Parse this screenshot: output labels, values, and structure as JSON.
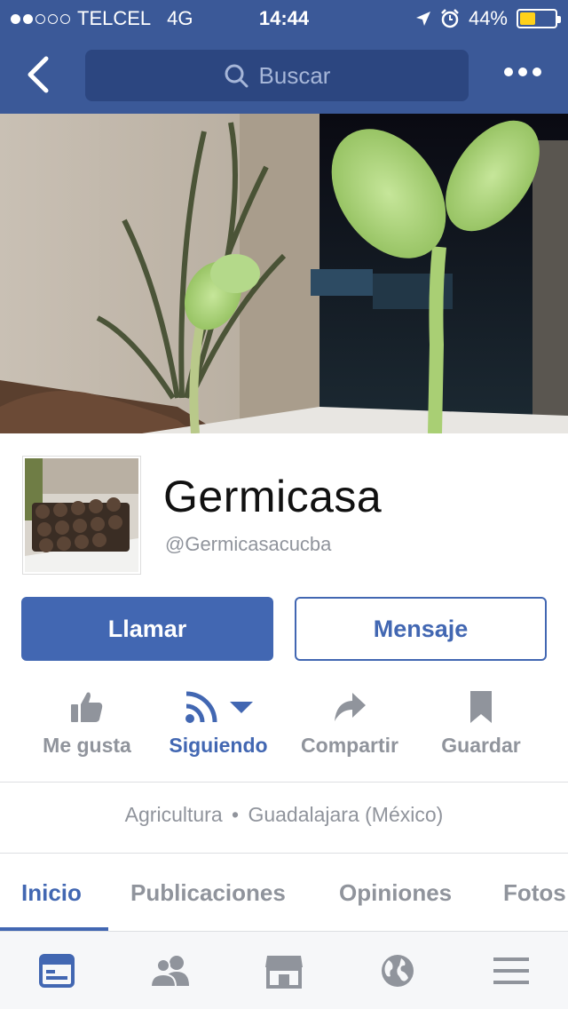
{
  "status_bar": {
    "carrier": "TELCEL",
    "network": "4G",
    "time": "14:44",
    "battery": "44%",
    "battery_level": 0.44
  },
  "nav": {
    "search_placeholder": "Buscar"
  },
  "page": {
    "name": "Germicasa",
    "handle": "@Germicasacucba"
  },
  "cta": {
    "call_label": "Llamar",
    "message_label": "Mensaje"
  },
  "actions": [
    {
      "label": "Me gusta",
      "icon": "thumbs-up-icon"
    },
    {
      "label": "Siguiendo",
      "icon": "rss-icon"
    },
    {
      "label": "Compartir",
      "icon": "share-icon"
    },
    {
      "label": "Guardar",
      "icon": "bookmark-icon"
    }
  ],
  "info": {
    "category": "Agricultura",
    "location": "Guadalajara (México)"
  },
  "tabs": [
    "Inicio",
    "Publicaciones",
    "Opiniones",
    "Fotos"
  ],
  "bottom_nav": [
    "news-feed-icon",
    "friends-icon",
    "marketplace-icon",
    "globe-icon",
    "menu-icon"
  ],
  "colors": {
    "brand": "#3b5998",
    "accent": "#4267b2",
    "muted": "#90949c"
  }
}
